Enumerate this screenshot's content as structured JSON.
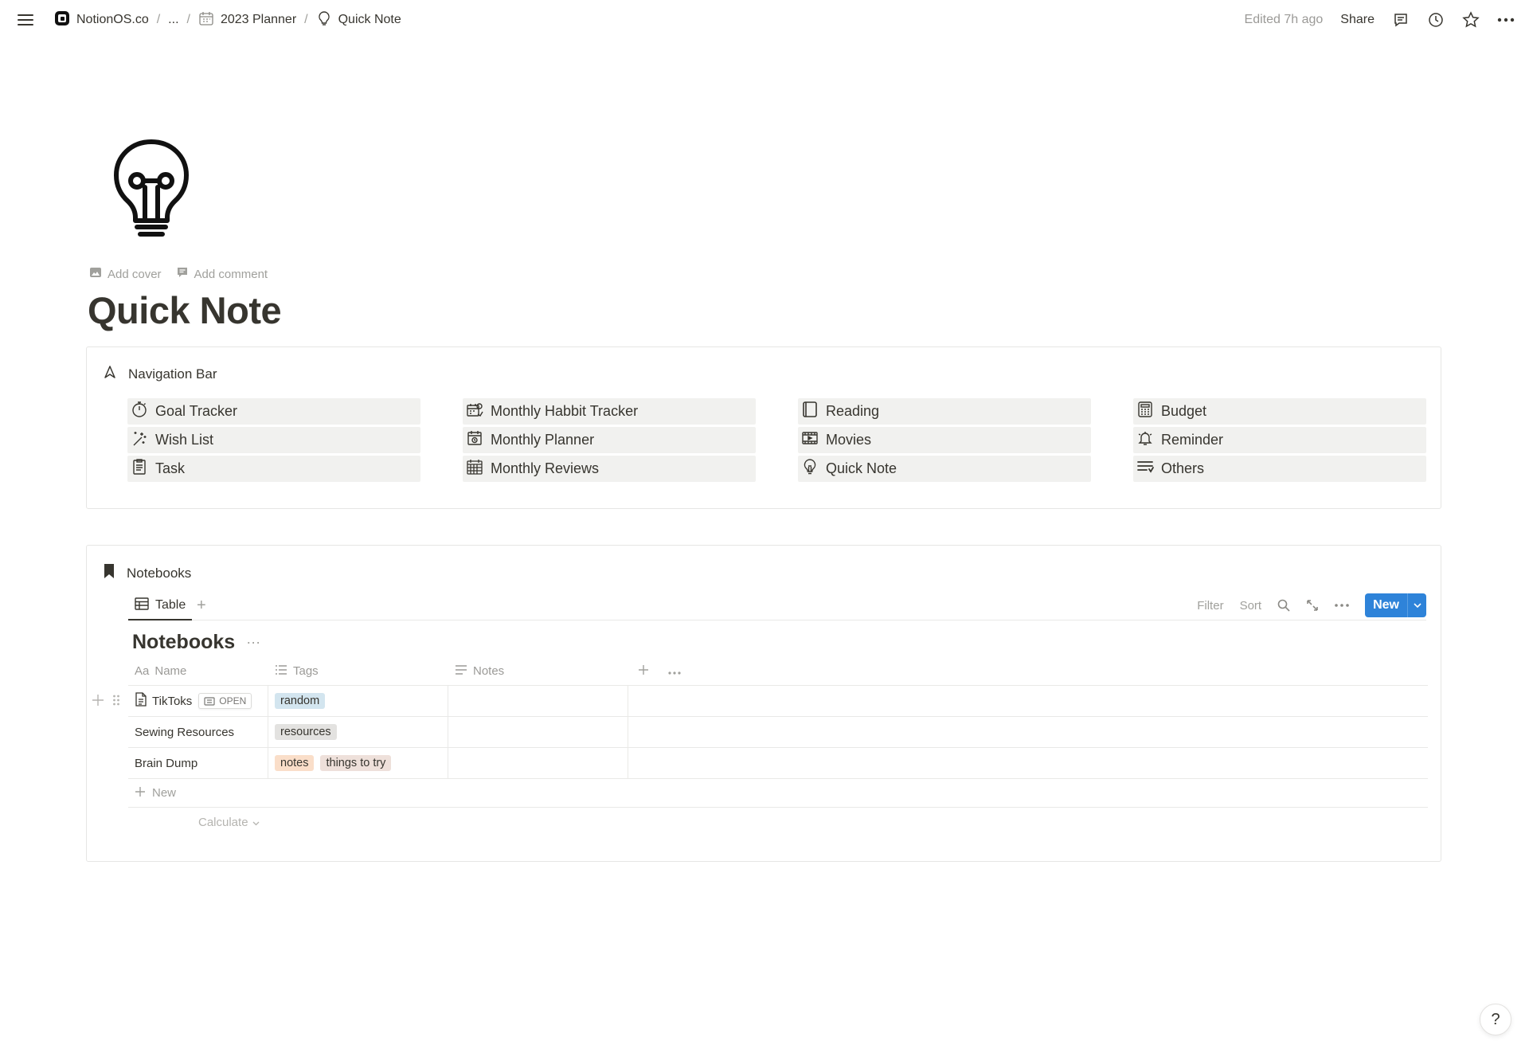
{
  "breadcrumbs": [
    {
      "label": "NotionOS.co",
      "icon": "notion-os-logo-icon"
    },
    {
      "label": "..."
    },
    {
      "label": "2023 Planner",
      "icon": "calendar-icon"
    },
    {
      "label": "Quick Note",
      "icon": "lightbulb-icon"
    }
  ],
  "topbar": {
    "edited": "Edited 7h ago",
    "share": "Share"
  },
  "page": {
    "icon": "lightbulb-icon",
    "add_cover": "Add cover",
    "add_comment": "Add comment",
    "title": "Quick Note"
  },
  "navigation": {
    "heading": "Navigation Bar",
    "items": [
      {
        "label": "Goal Tracker",
        "icon": "stopwatch-icon"
      },
      {
        "label": "Monthly Habbit Tracker",
        "icon": "habit-icon"
      },
      {
        "label": "Reading",
        "icon": "book-icon"
      },
      {
        "label": "Budget",
        "icon": "calculator-icon"
      },
      {
        "label": "Wish List",
        "icon": "sparkle-icon"
      },
      {
        "label": "Monthly Planner",
        "icon": "calendar-icon"
      },
      {
        "label": "Movies",
        "icon": "film-icon"
      },
      {
        "label": "Reminder",
        "icon": "bell-icon"
      },
      {
        "label": "Task",
        "icon": "clipboard-icon"
      },
      {
        "label": "Monthly Reviews",
        "icon": "calendar-grid-icon"
      },
      {
        "label": "Quick Note",
        "icon": "lightbulb-icon"
      },
      {
        "label": "Others",
        "icon": "list-icon"
      }
    ]
  },
  "notebooks": {
    "heading": "Notebooks",
    "tab": "Table",
    "tools": {
      "filter": "Filter",
      "sort": "Sort",
      "new": "New"
    },
    "title": "Notebooks",
    "title_more": "···",
    "columns": {
      "name": "Name",
      "name_prefix": "Aa",
      "tags": "Tags",
      "notes": "Notes"
    },
    "rows": [
      {
        "name": "TikToks",
        "open": "OPEN",
        "tags": [
          {
            "label": "random",
            "color": "#d3e5ef"
          }
        ]
      },
      {
        "name": "Sewing Resources",
        "tags": [
          {
            "label": "resources",
            "color": "#e3e2e0"
          }
        ]
      },
      {
        "name": "Brain Dump",
        "tags": [
          {
            "label": "notes",
            "color": "#fadec9"
          },
          {
            "label": "things to try",
            "color": "#eee0da"
          }
        ]
      }
    ],
    "new_row": "New",
    "calculate": "Calculate"
  },
  "help": "?",
  "colors": {
    "accent": "#2e83d9",
    "text": "#37352f",
    "muted": "#9b9a97",
    "nav_bg": "#f1f1ef"
  }
}
